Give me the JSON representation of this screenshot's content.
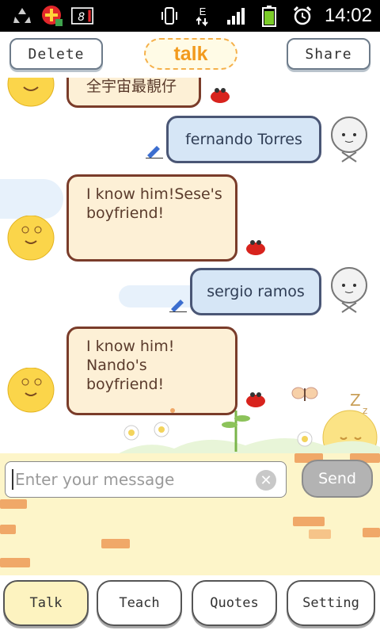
{
  "status_bar": {
    "time": "14:02",
    "network_label": "E",
    "notification_count": "8",
    "icons": [
      "recycle-icon",
      "plus-badge-icon",
      "notification-count-icon",
      "vibrate-icon",
      "data-arrows-icon",
      "signal-icon",
      "battery-icon",
      "alarm-icon"
    ]
  },
  "toolbar": {
    "delete_label": "Delete",
    "title": "talk",
    "share_label": "Share"
  },
  "messages": [
    {
      "side": "left",
      "text": "全宇宙最靚仔"
    },
    {
      "side": "right",
      "text": "fernando Torres"
    },
    {
      "side": "left",
      "text": "I know him!Sese's boyfriend!"
    },
    {
      "side": "right",
      "text": "sergio ramos"
    },
    {
      "side": "left",
      "text": "I know him! Nando's boyfriend!"
    }
  ],
  "composer": {
    "placeholder": "Enter your message",
    "value": "",
    "send_label": "Send"
  },
  "tabs": [
    {
      "label": "Talk",
      "active": true
    },
    {
      "label": "Teach",
      "active": false
    },
    {
      "label": "Quotes",
      "active": false
    },
    {
      "label": "Setting",
      "active": false
    }
  ],
  "colors": {
    "left_bubble_fill": "#fdf0d6",
    "left_bubble_border": "#7a3c2a",
    "right_bubble_fill": "#d6e6f6",
    "right_bubble_border": "#4a5675",
    "talk_accent": "#f29a1d",
    "composer_background": "#fdf5c9"
  }
}
